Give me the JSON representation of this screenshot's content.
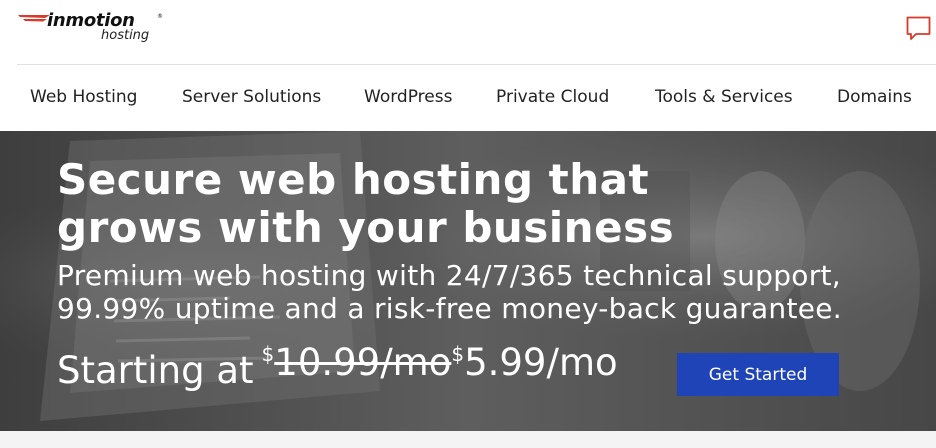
{
  "header": {
    "logo_main": "inmotion",
    "logo_reg": "®",
    "logo_sub": "hosting",
    "chat_icon": "chat-bubble-icon",
    "accent_color": "#d93a2b"
  },
  "nav": {
    "items": [
      {
        "label": "Web Hosting"
      },
      {
        "label": "Server Solutions"
      },
      {
        "label": "WordPress"
      },
      {
        "label": "Private Cloud"
      },
      {
        "label": "Tools & Services"
      },
      {
        "label": "Domains"
      }
    ]
  },
  "hero": {
    "title": "Secure web hosting that grows with your business",
    "subtitle": "Premium web hosting with 24/7/365 technical support, 99.99% uptime and a risk-free money-back guarantee.",
    "price": {
      "lead": "Starting at",
      "currency": "$",
      "old_price": "10.99/mo",
      "new_price": "5.99/mo"
    },
    "cta_label": "Get Started",
    "cta_color": "#1f44b8"
  }
}
